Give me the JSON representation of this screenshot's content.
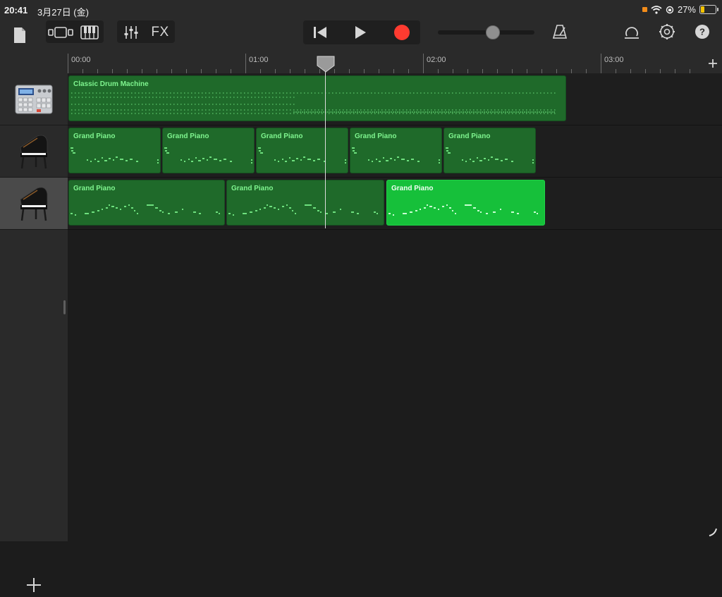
{
  "status_bar": {
    "time": "20:41",
    "date": "3月27日 (金)",
    "battery_percent_text": "27%",
    "battery_level": 0.27
  },
  "toolbar": {
    "buttons": [
      {
        "name": "my-songs-icon"
      },
      {
        "name": "tracks-view-icon"
      },
      {
        "name": "keyboard-icon"
      },
      {
        "name": "mixer-icon"
      },
      {
        "name": "fx-label",
        "label": "FX"
      },
      {
        "name": "rewind-icon"
      },
      {
        "name": "play-icon"
      },
      {
        "name": "record-icon"
      },
      {
        "name": "metronome-icon"
      },
      {
        "name": "loop-browser-icon"
      },
      {
        "name": "settings-icon"
      },
      {
        "name": "help-icon"
      }
    ],
    "master_volume_level": 0.57,
    "record_color": "#ff3b30"
  },
  "ruler": {
    "labels": [
      "00:00",
      "01:00",
      "02:00",
      "03:00"
    ],
    "add_section_label": "+"
  },
  "tracks": [
    {
      "instrument": "drum-machine",
      "regions": [
        {
          "name": "Classic Drum Machine",
          "selected": false
        }
      ]
    },
    {
      "instrument": "grand-piano",
      "regions": [
        {
          "name": "Grand Piano",
          "selected": false
        },
        {
          "name": "Grand Piano",
          "selected": false
        },
        {
          "name": "Grand Piano",
          "selected": false
        },
        {
          "name": "Grand Piano",
          "selected": false
        },
        {
          "name": "Grand Piano",
          "selected": false
        }
      ]
    },
    {
      "instrument": "grand-piano",
      "selected": true,
      "regions": [
        {
          "name": "Grand Piano",
          "selected": false
        },
        {
          "name": "Grand Piano",
          "selected": false
        },
        {
          "name": "Grand Piano",
          "selected": true
        }
      ]
    }
  ],
  "add_track_label": "+",
  "colors": {
    "region": "#1f6a2a",
    "region_selected": "#16c03a",
    "region_text": "#7ff58f"
  }
}
